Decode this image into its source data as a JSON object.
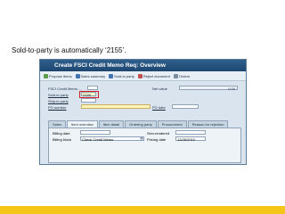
{
  "caption": "Sold-to-party is automatically ‘2155’.",
  "window": {
    "title": "Create FSCI Credit Memo Req: Overview"
  },
  "toolbar": {
    "items": [
      {
        "label": "Propose items",
        "icon": "propose-icon"
      },
      {
        "label": "Sales summary",
        "icon": "summary-icon"
      },
      {
        "label": "Sold-to party",
        "icon": "party-icon"
      },
      {
        "label": "Reject document",
        "icon": "reject-icon"
      },
      {
        "label": "Orders",
        "icon": "orders-icon"
      }
    ]
  },
  "header": {
    "doc_type_label": "FSCI Credit Memo ...",
    "net_value_label": "Net value",
    "net_value": "0.00",
    "sold_to_label": "Sold-to party",
    "sold_to_value": "2155",
    "ship_to_label": "Ship-to party",
    "po_label": "PO number",
    "po_date_label": "PO date"
  },
  "tabs": [
    {
      "label": "Sales",
      "active": false
    },
    {
      "label": "Item overview",
      "active": true
    },
    {
      "label": "Item detail",
      "active": false
    },
    {
      "label": "Ordering party",
      "active": false
    },
    {
      "label": "Procurement",
      "active": false
    },
    {
      "label": "Reason for rejection",
      "active": false
    }
  ],
  "item_overview": {
    "billing_date_label": "Billing date",
    "serv_rendered_label": "Serv.rendered",
    "billing_block_label": "Billing block",
    "billing_block_value": "Check Credit Memo",
    "pricing_date_label": "Pricing date",
    "pricing_date_value": "12/26/2010"
  },
  "colors": {
    "footer": "#f5c518",
    "titlebar": "#1d4670"
  }
}
